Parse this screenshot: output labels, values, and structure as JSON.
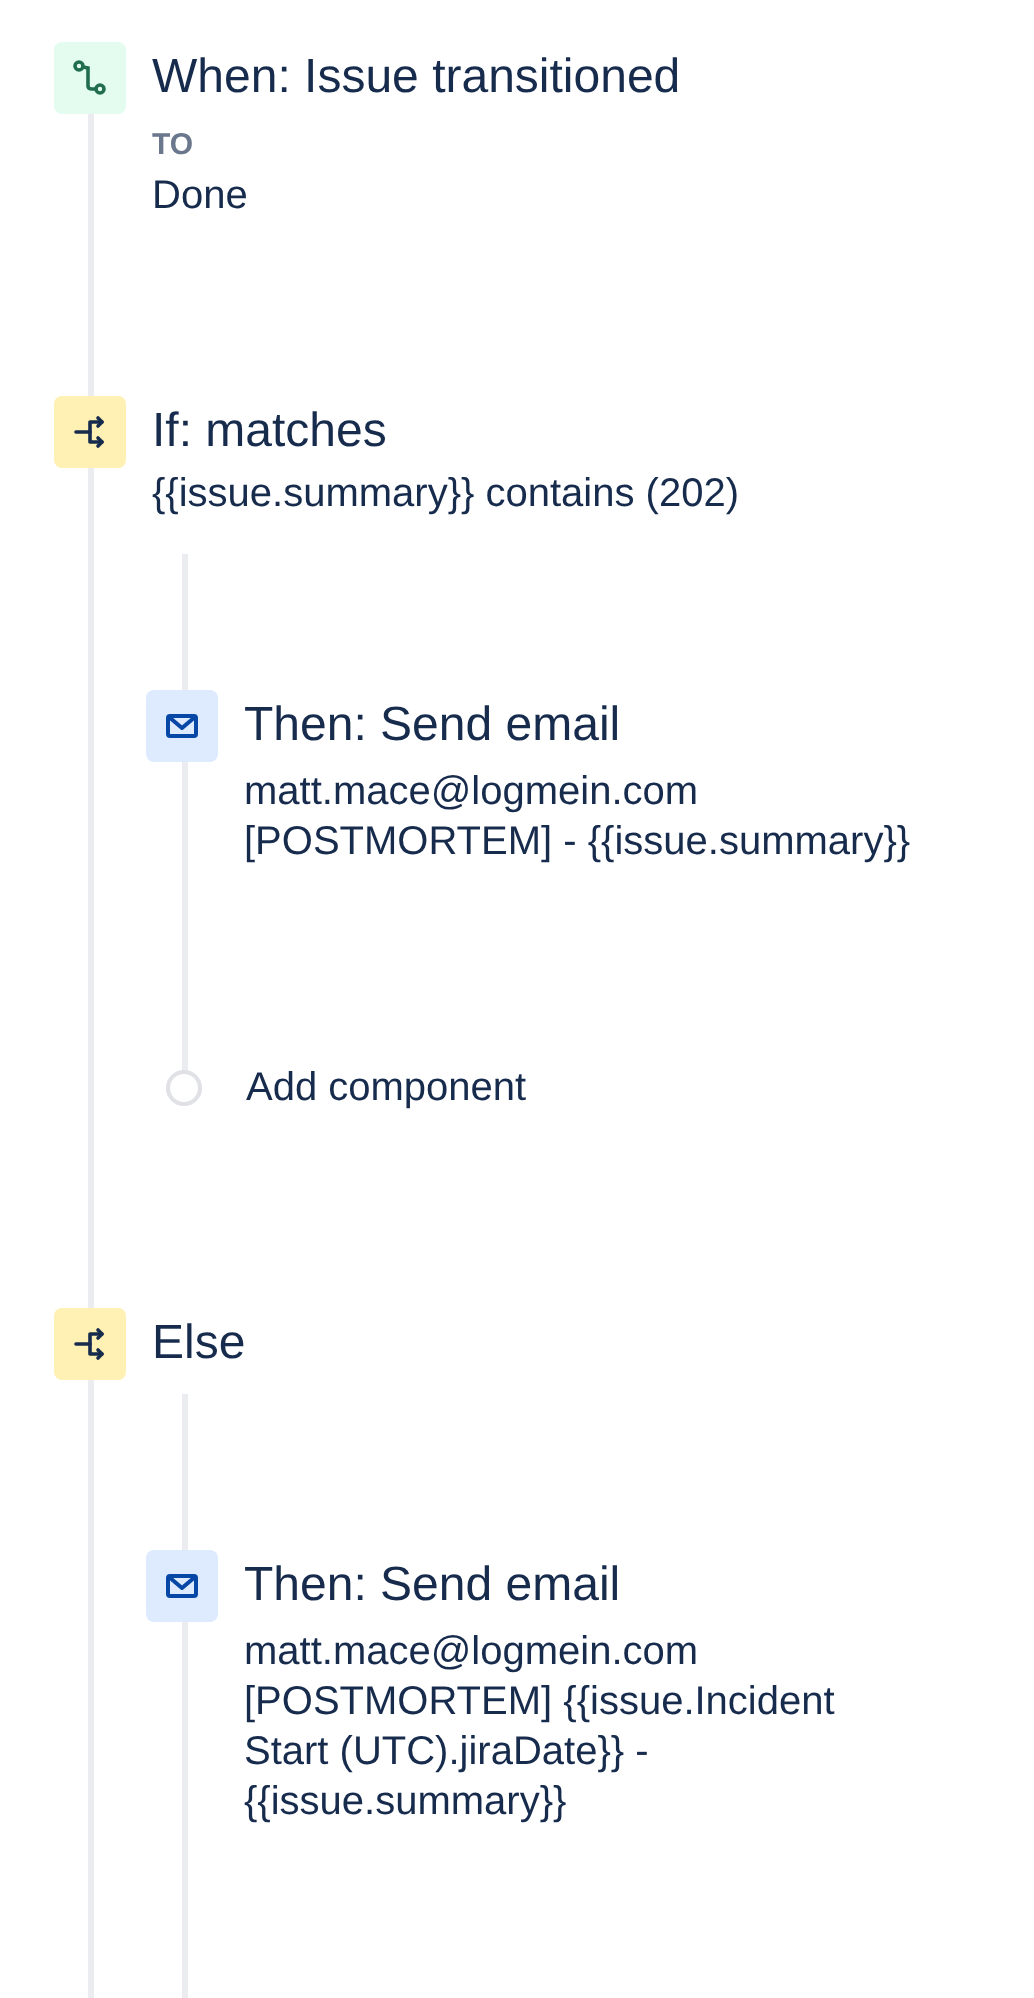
{
  "steps": [
    {
      "kind": "trigger",
      "title": "When: Issue transitioned",
      "label": "TO",
      "value": "Done"
    },
    {
      "kind": "condition",
      "title": "If: matches",
      "detail": "{{issue.summary}} contains (202)",
      "children": [
        {
          "kind": "action",
          "title": "Then: Send email",
          "to": "matt.mace@logmein.com",
          "subject": "[POSTMORTEM] - {{issue.summary}}"
        },
        {
          "kind": "add",
          "title": "Add component"
        }
      ]
    },
    {
      "kind": "condition",
      "title": "Else",
      "children": [
        {
          "kind": "action",
          "title": "Then: Send email",
          "to": "matt.mace@logmein.com",
          "subject": "[POSTMORTEM] {{issue.Incident Start (UTC).jiraDate}} - {{issue.summary}}"
        }
      ]
    }
  ]
}
